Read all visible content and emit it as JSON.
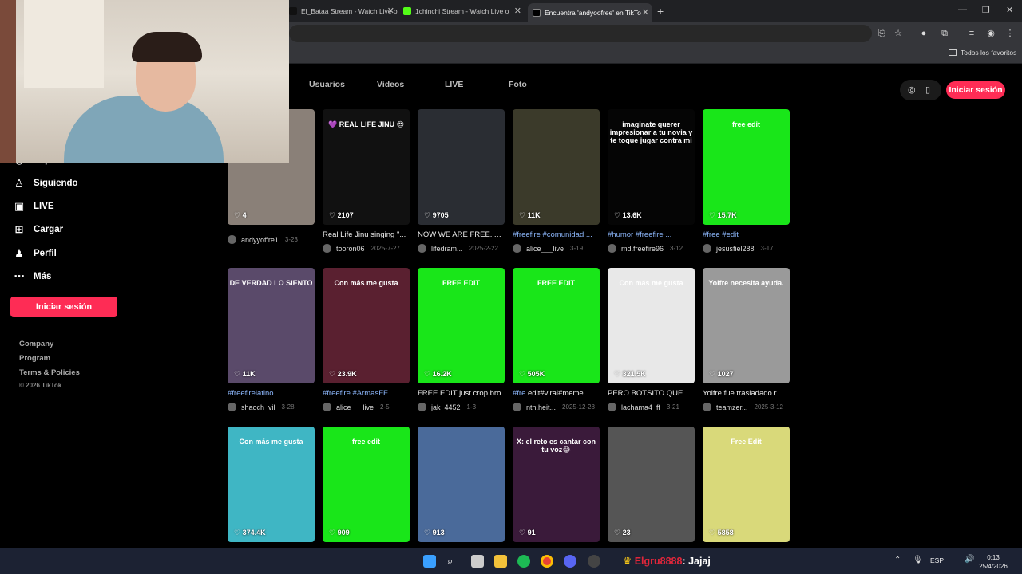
{
  "browser": {
    "tabs": [
      {
        "title": "El_Bataa Stream - Watch Live o",
        "active": false
      },
      {
        "title": "1chinchi Stream - Watch Live o",
        "active": false
      },
      {
        "title": "Encuentra 'andyoofree' en TikTo",
        "active": true
      }
    ],
    "new_tab_symbol": "+",
    "bookmarks_label": "Todos los favoritos"
  },
  "sidebar": {
    "items": [
      {
        "label": "Explorar",
        "icon": "compass-icon"
      },
      {
        "label": "Siguiendo",
        "icon": "user-follow-icon"
      },
      {
        "label": "LIVE",
        "icon": "live-tv-icon"
      },
      {
        "label": "Cargar",
        "icon": "upload-plus-icon"
      },
      {
        "label": "Perfil",
        "icon": "profile-icon"
      },
      {
        "label": "Más",
        "icon": "more-dots-icon"
      }
    ],
    "login_label": "Iniciar sesión",
    "footer": {
      "company": "Company",
      "program": "Program",
      "terms": "Terms & Policies",
      "copyright": "© 2026 TikTok"
    }
  },
  "search_tabs": [
    "Usuarios",
    "Videos",
    "LIVE",
    "Foto"
  ],
  "header": {
    "login_label": "Iniciar sesión"
  },
  "videos": [
    {
      "likes": "4",
      "desc_pre": "",
      "desc_tag": "",
      "desc_post": "",
      "user": "andyyoffre1",
      "date": "3-23",
      "bg": "#8a8078",
      "overlay": ""
    },
    {
      "likes": "2107",
      "desc_pre": "Real Life Jinu singing \"...",
      "desc_tag": "",
      "desc_post": "",
      "user": "tooron06",
      "date": "2025-7-27",
      "bg": "#111111",
      "overlay": "💜 REAL LIFE JINU 😍"
    },
    {
      "likes": "9705",
      "desc_pre": "NOW WE ARE FREE. A...",
      "desc_tag": "",
      "desc_post": "",
      "user": "lifedram...",
      "date": "2025-2-22",
      "bg": "#2a2d33",
      "overlay": ""
    },
    {
      "likes": "11K",
      "desc_pre": "",
      "desc_tag": "#freefire #comunidad ...",
      "desc_post": "",
      "user": "alice___live",
      "date": "3-19",
      "bg": "#3b3a2a",
      "overlay": ""
    },
    {
      "likes": "13.6K",
      "desc_pre": "",
      "desc_tag": "#humor #freefire ...",
      "desc_post": "",
      "user": "md.freefire96",
      "date": "3-12",
      "bg": "#050505",
      "overlay": "imaginate querer impresionar a tu novia y te toque jugar contra mi"
    },
    {
      "likes": "15.7K",
      "desc_pre": "",
      "desc_tag": "#free #edit",
      "desc_post": "",
      "user": "jesusfiel288",
      "date": "3-17",
      "bg": "#19e619",
      "overlay": "free edit"
    },
    {
      "likes": "11K",
      "desc_pre": "",
      "desc_tag": "#freefirelatino ...",
      "desc_post": "",
      "user": "shaoch_vil",
      "date": "3-28",
      "bg": "#5a4a6a",
      "overlay": "DE VERDAD LO SIENTO"
    },
    {
      "likes": "23.9K",
      "desc_pre": "",
      "desc_tag": "#freefire #ArmasFF ...",
      "desc_post": "",
      "user": "alice___live",
      "date": "2-5",
      "bg": "#5a2030",
      "overlay": "Con más me gusta"
    },
    {
      "likes": "16.2K",
      "desc_pre": "FREE EDIT just crop bro",
      "desc_tag": "",
      "desc_post": "",
      "user": "jak_4452",
      "date": "1-3",
      "bg": "#19e619",
      "overlay": "FREE EDIT"
    },
    {
      "likes": "505K",
      "desc_pre": "",
      "desc_tag": "#fre",
      "desc_post": " edit#viral#meme...",
      "user": "nth.heit...",
      "date": "2025-12-28",
      "bg": "#19e619",
      "overlay": "FREE EDIT"
    },
    {
      "likes": "321.5K",
      "desc_pre": "PERO BOTSITO QUE F...",
      "desc_tag": "",
      "desc_post": "",
      "user": "lachama4_ff",
      "date": "3-21",
      "bg": "#e8e8e8",
      "overlay": "Con más me gusta"
    },
    {
      "likes": "1027",
      "desc_pre": "Yoifre fue trasladado r...",
      "desc_tag": "",
      "desc_post": "",
      "user": "teamzer...",
      "date": "2025-3-12",
      "bg": "#9a9a9a",
      "overlay": "Yoifre necesita ayuda."
    },
    {
      "likes": "374.4K",
      "desc_pre": "",
      "desc_tag": "",
      "desc_post": "",
      "user": "",
      "date": "",
      "bg": "#3fb6c4",
      "overlay": "Con más me gusta"
    },
    {
      "likes": "909",
      "desc_pre": "",
      "desc_tag": "",
      "desc_post": "",
      "user": "",
      "date": "",
      "bg": "#19e619",
      "overlay": "free edit"
    },
    {
      "likes": "913",
      "desc_pre": "",
      "desc_tag": "",
      "desc_post": "",
      "user": "",
      "date": "",
      "bg": "#4a6a9a",
      "overlay": ""
    },
    {
      "likes": "91",
      "desc_pre": "",
      "desc_tag": "",
      "desc_post": "",
      "user": "",
      "date": "",
      "bg": "#3a1a3a",
      "overlay": "X: el reto es cantar con tu voz😂"
    },
    {
      "likes": "23",
      "desc_pre": "",
      "desc_tag": "",
      "desc_post": "",
      "user": "",
      "date": "",
      "bg": "#555555",
      "overlay": ""
    },
    {
      "likes": "5858",
      "desc_pre": "",
      "desc_tag": "",
      "desc_post": "",
      "user": "",
      "date": "",
      "bg": "#d9d97a",
      "overlay": "Free Edit"
    }
  ],
  "taskbar": {
    "chat_user": "Elgru8888",
    "chat_text": ": Jajaj",
    "lang": "ESP",
    "time": "0:13",
    "date": "25/4/2026"
  }
}
